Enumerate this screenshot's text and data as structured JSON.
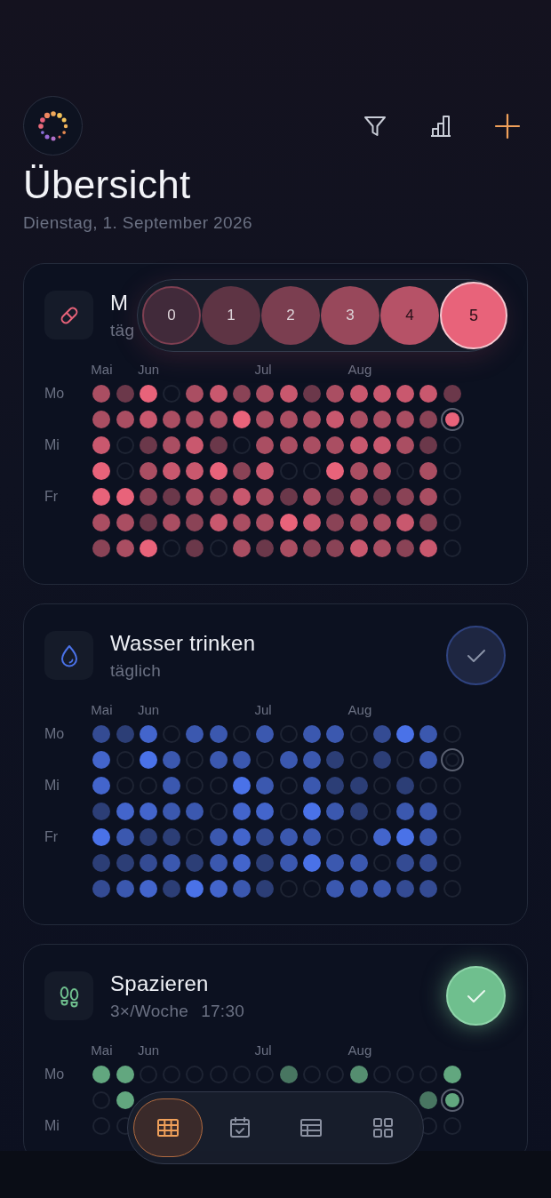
{
  "header": {
    "title": "Übersicht",
    "date": "Dienstag, 1. September 2026"
  },
  "cards": [
    {
      "title": "M",
      "schedule": "täg",
      "color": "#e8637a",
      "rows": [
        {
          "label": "Mo",
          "cells": [
            {
              "filled": true,
              "color": "#aa4e62",
              "month": "Mai"
            },
            {
              "filled": true,
              "color": "#6b384a"
            },
            {
              "filled": true,
              "color": "#e8637a",
              "month": "Jun"
            },
            {
              "filled": false
            },
            {
              "filled": true,
              "color": "#aa4e62"
            },
            {
              "filled": true,
              "color": "#c9586e"
            },
            {
              "filled": true,
              "color": "#8a4356"
            },
            {
              "filled": true,
              "color": "#aa4e62",
              "month": "Jul"
            },
            {
              "filled": true,
              "color": "#c9586e"
            },
            {
              "filled": true,
              "color": "#6b384a"
            },
            {
              "filled": true,
              "color": "#aa4e62"
            },
            {
              "filled": true,
              "color": "#c9586e",
              "month": "Aug"
            },
            {
              "filled": true,
              "color": "#c9586e"
            },
            {
              "filled": true,
              "color": "#c9586e"
            },
            {
              "filled": true,
              "color": "#c9586e"
            },
            {
              "filled": true,
              "color": "#6b384a"
            }
          ]
        },
        {
          "cells": [
            {
              "filled": true,
              "color": "#aa4e62"
            },
            {
              "filled": true,
              "color": "#aa4e62"
            },
            {
              "filled": true,
              "color": "#c9586e"
            },
            {
              "filled": true,
              "color": "#aa4e62"
            },
            {
              "filled": true,
              "color": "#aa4e62"
            },
            {
              "filled": true,
              "color": "#aa4e62"
            },
            {
              "filled": true,
              "color": "#e8637a"
            },
            {
              "filled": true,
              "color": "#aa4e62"
            },
            {
              "filled": true,
              "color": "#aa4e62"
            },
            {
              "filled": true,
              "color": "#aa4e62"
            },
            {
              "filled": true,
              "color": "#c9586e"
            },
            {
              "filled": true,
              "color": "#aa4e62"
            },
            {
              "filled": true,
              "color": "#aa4e62"
            },
            {
              "filled": true,
              "color": "#aa4e62"
            },
            {
              "filled": true,
              "color": "#8a4356"
            },
            {
              "filled": true,
              "color": "#e8637a",
              "today": true
            }
          ]
        },
        {
          "label": "Mi",
          "cells": [
            {
              "filled": true,
              "color": "#c9586e"
            },
            {
              "filled": false
            },
            {
              "filled": true,
              "color": "#6b384a"
            },
            {
              "filled": true,
              "color": "#aa4e62"
            },
            {
              "filled": true,
              "color": "#c9586e"
            },
            {
              "filled": true,
              "color": "#6b384a"
            },
            {
              "filled": false
            },
            {
              "filled": true,
              "color": "#aa4e62"
            },
            {
              "filled": true,
              "color": "#aa4e62"
            },
            {
              "filled": true,
              "color": "#aa4e62"
            },
            {
              "filled": true,
              "color": "#aa4e62"
            },
            {
              "filled": true,
              "color": "#c9586e"
            },
            {
              "filled": true,
              "color": "#c9586e"
            },
            {
              "filled": true,
              "color": "#aa4e62"
            },
            {
              "filled": true,
              "color": "#6b384a"
            },
            {
              "filled": false
            }
          ]
        },
        {
          "cells": [
            {
              "filled": true,
              "color": "#e8637a"
            },
            {
              "filled": false
            },
            {
              "filled": true,
              "color": "#aa4e62"
            },
            {
              "filled": true,
              "color": "#c9586e"
            },
            {
              "filled": true,
              "color": "#c9586e"
            },
            {
              "filled": true,
              "color": "#e8637a"
            },
            {
              "filled": true,
              "color": "#8a4356"
            },
            {
              "filled": true,
              "color": "#c9586e"
            },
            {
              "filled": false
            },
            {
              "filled": false
            },
            {
              "filled": true,
              "color": "#e8637a"
            },
            {
              "filled": true,
              "color": "#aa4e62"
            },
            {
              "filled": true,
              "color": "#aa4e62"
            },
            {
              "filled": false
            },
            {
              "filled": true,
              "color": "#aa4e62"
            },
            {
              "filled": false
            }
          ]
        },
        {
          "label": "Fr",
          "cells": [
            {
              "filled": true,
              "color": "#e8637a"
            },
            {
              "filled": true,
              "color": "#e8637a"
            },
            {
              "filled": true,
              "color": "#8a4356"
            },
            {
              "filled": true,
              "color": "#6b384a"
            },
            {
              "filled": true,
              "color": "#aa4e62"
            },
            {
              "filled": true,
              "color": "#8a4356"
            },
            {
              "filled": true,
              "color": "#c9586e"
            },
            {
              "filled": true,
              "color": "#aa4e62"
            },
            {
              "filled": true,
              "color": "#6b384a"
            },
            {
              "filled": true,
              "color": "#aa4e62"
            },
            {
              "filled": true,
              "color": "#6b384a"
            },
            {
              "filled": true,
              "color": "#aa4e62"
            },
            {
              "filled": true,
              "color": "#6b384a"
            },
            {
              "filled": true,
              "color": "#8a4356"
            },
            {
              "filled": true,
              "color": "#aa4e62"
            },
            {
              "filled": false
            }
          ]
        },
        {
          "cells": [
            {
              "filled": true,
              "color": "#aa4e62"
            },
            {
              "filled": true,
              "color": "#aa4e62"
            },
            {
              "filled": true,
              "color": "#6b384a"
            },
            {
              "filled": true,
              "color": "#aa4e62"
            },
            {
              "filled": true,
              "color": "#8a4356"
            },
            {
              "filled": true,
              "color": "#c9586e"
            },
            {
              "filled": true,
              "color": "#aa4e62"
            },
            {
              "filled": true,
              "color": "#aa4e62"
            },
            {
              "filled": true,
              "color": "#e8637a"
            },
            {
              "filled": true,
              "color": "#c9586e"
            },
            {
              "filled": true,
              "color": "#8a4356"
            },
            {
              "filled": true,
              "color": "#aa4e62"
            },
            {
              "filled": true,
              "color": "#aa4e62"
            },
            {
              "filled": true,
              "color": "#c9586e"
            },
            {
              "filled": true,
              "color": "#8a4356"
            },
            {
              "filled": false
            }
          ]
        },
        {
          "cells": [
            {
              "filled": true,
              "color": "#8a4356"
            },
            {
              "filled": true,
              "color": "#aa4e62"
            },
            {
              "filled": true,
              "color": "#e8637a"
            },
            {
              "filled": false
            },
            {
              "filled": true,
              "color": "#6b384a"
            },
            {
              "filled": false
            },
            {
              "filled": true,
              "color": "#aa4e62"
            },
            {
              "filled": true,
              "color": "#6b384a"
            },
            {
              "filled": true,
              "color": "#aa4e62"
            },
            {
              "filled": true,
              "color": "#8a4356"
            },
            {
              "filled": true,
              "color": "#8a4356"
            },
            {
              "filled": true,
              "color": "#c9586e"
            },
            {
              "filled": true,
              "color": "#aa4e62"
            },
            {
              "filled": true,
              "color": "#8a4356"
            },
            {
              "filled": true,
              "color": "#c9586e"
            },
            {
              "filled": false
            }
          ]
        }
      ],
      "level_picker": {
        "options": [
          {
            "label": "0",
            "selected": false
          },
          {
            "label": "1",
            "selected": false
          },
          {
            "label": "2",
            "selected": false
          },
          {
            "label": "3",
            "selected": false
          },
          {
            "label": "4",
            "selected": false
          },
          {
            "label": "5",
            "selected": true
          }
        ]
      }
    },
    {
      "title": "Wasser trinken",
      "schedule": "täglich",
      "color": "#4a72e8",
      "done": false,
      "rows": [
        {
          "label": "Mo",
          "cells": [
            {
              "filled": true,
              "color": "#344b93",
              "month": "Mai"
            },
            {
              "filled": true,
              "color": "#2c3e76"
            },
            {
              "filled": true,
              "color": "#4365cc",
              "month": "Jun"
            },
            {
              "filled": false
            },
            {
              "filled": true,
              "color": "#3b58af"
            },
            {
              "filled": true,
              "color": "#3b58af"
            },
            {
              "filled": false
            },
            {
              "filled": true,
              "color": "#3b58af",
              "month": "Jul"
            },
            {
              "filled": false
            },
            {
              "filled": true,
              "color": "#3b58af"
            },
            {
              "filled": true,
              "color": "#3b58af"
            },
            {
              "filled": false,
              "month": "Aug"
            },
            {
              "filled": true,
              "color": "#344b93"
            },
            {
              "filled": true,
              "color": "#4a72e8"
            },
            {
              "filled": true,
              "color": "#3b58af"
            },
            {
              "filled": false
            }
          ]
        },
        {
          "cells": [
            {
              "filled": true,
              "color": "#4365cc"
            },
            {
              "filled": false
            },
            {
              "filled": true,
              "color": "#4a72e8"
            },
            {
              "filled": true,
              "color": "#3b58af"
            },
            {
              "filled": false
            },
            {
              "filled": true,
              "color": "#3b58af"
            },
            {
              "filled": true,
              "color": "#3b58af"
            },
            {
              "filled": false
            },
            {
              "filled": true,
              "color": "#3b58af"
            },
            {
              "filled": true,
              "color": "#3b58af"
            },
            {
              "filled": true,
              "color": "#2c3e76"
            },
            {
              "filled": false
            },
            {
              "filled": true,
              "color": "#2c3e76"
            },
            {
              "filled": false
            },
            {
              "filled": true,
              "color": "#3b58af"
            },
            {
              "filled": false,
              "today": true
            }
          ]
        },
        {
          "label": "Mi",
          "cells": [
            {
              "filled": true,
              "color": "#4365cc"
            },
            {
              "filled": false
            },
            {
              "filled": false
            },
            {
              "filled": true,
              "color": "#3b58af"
            },
            {
              "filled": false
            },
            {
              "filled": false
            },
            {
              "filled": true,
              "color": "#4a72e8"
            },
            {
              "filled": true,
              "color": "#3b58af"
            },
            {
              "filled": false
            },
            {
              "filled": true,
              "color": "#3b58af"
            },
            {
              "filled": true,
              "color": "#2c3e76"
            },
            {
              "filled": true,
              "color": "#2c3e76"
            },
            {
              "filled": false
            },
            {
              "filled": true,
              "color": "#2c3e76"
            },
            {
              "filled": false
            },
            {
              "filled": false
            }
          ]
        },
        {
          "cells": [
            {
              "filled": true,
              "color": "#2c3e76"
            },
            {
              "filled": true,
              "color": "#4365cc"
            },
            {
              "filled": true,
              "color": "#4365cc"
            },
            {
              "filled": true,
              "color": "#3b58af"
            },
            {
              "filled": true,
              "color": "#3b58af"
            },
            {
              "filled": false
            },
            {
              "filled": true,
              "color": "#4365cc"
            },
            {
              "filled": true,
              "color": "#4365cc"
            },
            {
              "filled": false
            },
            {
              "filled": true,
              "color": "#4a72e8"
            },
            {
              "filled": true,
              "color": "#3b58af"
            },
            {
              "filled": true,
              "color": "#2c3e76"
            },
            {
              "filled": false
            },
            {
              "filled": true,
              "color": "#3b58af"
            },
            {
              "filled": true,
              "color": "#3b58af"
            },
            {
              "filled": false
            }
          ]
        },
        {
          "label": "Fr",
          "cells": [
            {
              "filled": true,
              "color": "#4a72e8"
            },
            {
              "filled": true,
              "color": "#3b58af"
            },
            {
              "filled": true,
              "color": "#2c3e76"
            },
            {
              "filled": true,
              "color": "#2c3e76"
            },
            {
              "filled": false
            },
            {
              "filled": true,
              "color": "#3b58af"
            },
            {
              "filled": true,
              "color": "#4365cc"
            },
            {
              "filled": true,
              "color": "#344b93"
            },
            {
              "filled": true,
              "color": "#3b58af"
            },
            {
              "filled": true,
              "color": "#3b58af"
            },
            {
              "filled": false
            },
            {
              "filled": false
            },
            {
              "filled": true,
              "color": "#4365cc"
            },
            {
              "filled": true,
              "color": "#4a72e8"
            },
            {
              "filled": true,
              "color": "#3b58af"
            },
            {
              "filled": false
            }
          ]
        },
        {
          "cells": [
            {
              "filled": true,
              "color": "#2c3e76"
            },
            {
              "filled": true,
              "color": "#2c3e76"
            },
            {
              "filled": true,
              "color": "#344b93"
            },
            {
              "filled": true,
              "color": "#3b58af"
            },
            {
              "filled": true,
              "color": "#2c3e76"
            },
            {
              "filled": true,
              "color": "#3b58af"
            },
            {
              "filled": true,
              "color": "#4365cc"
            },
            {
              "filled": true,
              "color": "#2c3e76"
            },
            {
              "filled": true,
              "color": "#3b58af"
            },
            {
              "filled": true,
              "color": "#4a72e8"
            },
            {
              "filled": true,
              "color": "#3b58af"
            },
            {
              "filled": true,
              "color": "#3b58af"
            },
            {
              "filled": false
            },
            {
              "filled": true,
              "color": "#344b93"
            },
            {
              "filled": true,
              "color": "#344b93"
            },
            {
              "filled": false
            }
          ]
        },
        {
          "cells": [
            {
              "filled": true,
              "color": "#344b93"
            },
            {
              "filled": true,
              "color": "#3b58af"
            },
            {
              "filled": true,
              "color": "#4365cc"
            },
            {
              "filled": true,
              "color": "#2c3e76"
            },
            {
              "filled": true,
              "color": "#4a72e8"
            },
            {
              "filled": true,
              "color": "#4365cc"
            },
            {
              "filled": true,
              "color": "#3b58af"
            },
            {
              "filled": true,
              "color": "#2c3e76"
            },
            {
              "filled": false
            },
            {
              "filled": false
            },
            {
              "filled": true,
              "color": "#3b58af"
            },
            {
              "filled": true,
              "color": "#3b58af"
            },
            {
              "filled": true,
              "color": "#3b58af"
            },
            {
              "filled": true,
              "color": "#344b93"
            },
            {
              "filled": true,
              "color": "#344b93"
            },
            {
              "filled": false
            }
          ]
        }
      ]
    },
    {
      "title": "Spazieren",
      "schedule": "3×/Woche",
      "time": "17:30",
      "color": "#6fbf8e",
      "done": true,
      "rows": [
        {
          "label": "Mo",
          "cells": [
            {
              "filled": true,
              "color": "#62a77f",
              "month": "Mai"
            },
            {
              "filled": true,
              "color": "#62a77f"
            },
            {
              "filled": false,
              "month": "Jun"
            },
            {
              "filled": false
            },
            {
              "filled": false
            },
            {
              "filled": false
            },
            {
              "filled": false
            },
            {
              "filled": false,
              "month": "Jul"
            },
            {
              "filled": true,
              "color": "#487661"
            },
            {
              "filled": false
            },
            {
              "filled": false
            },
            {
              "filled": true,
              "color": "#558e70",
              "month": "Aug"
            },
            {
              "filled": false
            },
            {
              "filled": false
            },
            {
              "filled": false
            },
            {
              "filled": true,
              "color": "#62a77f"
            }
          ]
        },
        {
          "cells": [
            {
              "filled": false
            },
            {
              "filled": true,
              "color": "#62a77f"
            }
          ],
          "end_cells": [
            {
              "filled": true,
              "color": "#487661"
            },
            {
              "filled": true,
              "color": "#62a77f",
              "today": true
            }
          ]
        },
        {
          "label": "Mi",
          "cells": [
            {
              "filled": false
            },
            {
              "filled": false
            }
          ],
          "end_cells": [
            {
              "filled": false
            },
            {
              "filled": false
            }
          ]
        }
      ]
    }
  ],
  "nav": [
    {
      "selected": true
    },
    {
      "selected": false
    },
    {
      "selected": false
    },
    {
      "selected": false
    }
  ]
}
